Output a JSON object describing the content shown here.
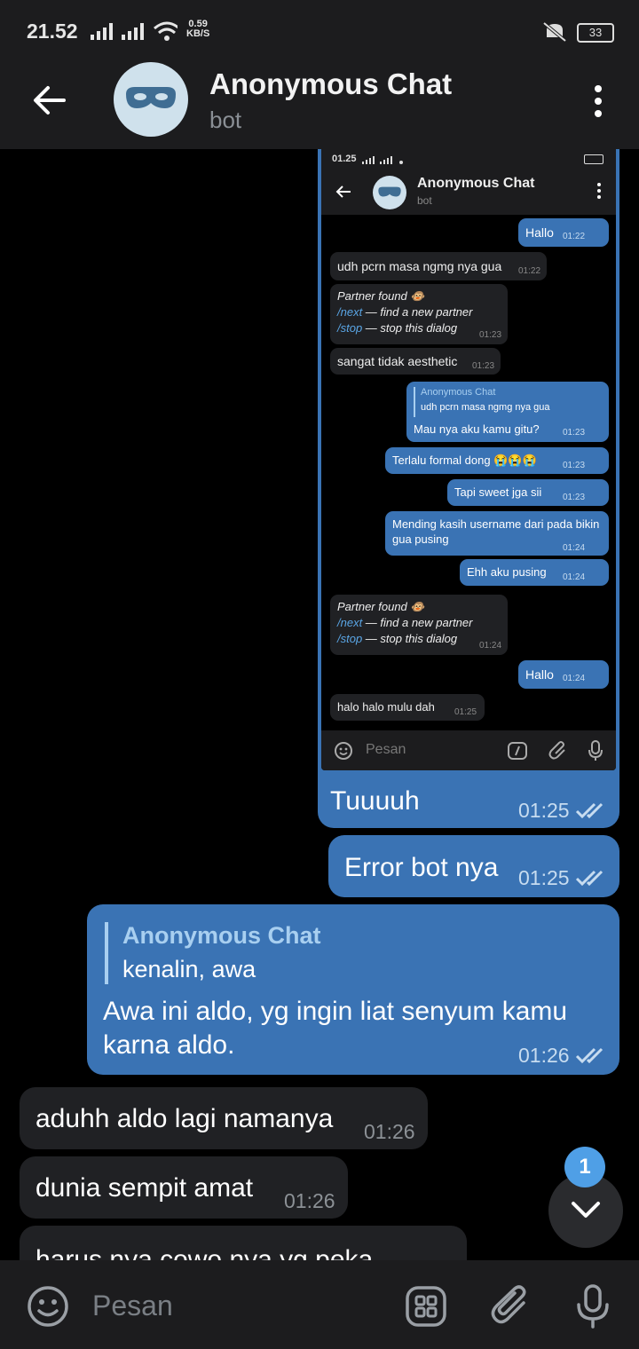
{
  "status_bar": {
    "time": "21.52",
    "speed_value": "0.59",
    "speed_unit": "KB/S",
    "battery": "33"
  },
  "header": {
    "title": "Anonymous Chat",
    "subtitle": "bot"
  },
  "embedded_screenshot": {
    "status_time": "01.25",
    "title": "Anonymous Chat",
    "subtitle": "bot",
    "messages": [
      {
        "dir": "out",
        "text": "Hallo",
        "time": "01:22"
      },
      {
        "dir": "in",
        "text": "udh pcrn masa ngmg nya gua",
        "time": "01:22"
      },
      {
        "dir": "in",
        "line1": "Partner found 🐵",
        "cmd1": "/next",
        "rest1": " — find a new partner",
        "cmd2": "/stop",
        "rest2": " — stop this dialog",
        "time": "01:23"
      },
      {
        "dir": "in",
        "text": "sangat tidak aesthetic",
        "time": "01:23"
      },
      {
        "dir": "out",
        "reply_name": "Anonymous Chat",
        "reply_text": "udh pcrn masa ngmg nya gua",
        "text": "Mau nya aku kamu gitu?",
        "time": "01:23"
      },
      {
        "dir": "out",
        "text": "Terlalu formal dong 😭😭😭",
        "time": "01:23"
      },
      {
        "dir": "out",
        "text": "Tapi sweet jga sii",
        "time": "01:23"
      },
      {
        "dir": "out",
        "text": "Mending kasih username dari pada bikin gua pusing",
        "time": "01:24"
      },
      {
        "dir": "out",
        "text": "Ehh aku pusing",
        "time": "01:24"
      },
      {
        "dir": "in",
        "line1": "Partner found 🐵",
        "cmd1": "/next",
        "rest1": " — find a new partner",
        "cmd2": "/stop",
        "rest2": " — stop this dialog",
        "time": "01:24"
      },
      {
        "dir": "out",
        "text": "Hallo",
        "time": "01:24"
      },
      {
        "dir": "in",
        "text": "halo halo mulu dah",
        "time": "01:25"
      }
    ],
    "input_placeholder": "Pesan"
  },
  "messages": [
    {
      "dir": "out",
      "text": "Tuuuuh",
      "time": "01:25"
    },
    {
      "dir": "out",
      "text": "Error bot nya",
      "time": "01:25"
    },
    {
      "dir": "out",
      "reply_name": "Anonymous Chat",
      "reply_text": "kenalin, awa",
      "text_line1": "Awa ini aldo, yg ingin liat senyum kamu",
      "text_line2": "karna aldo.",
      "time": "01:26"
    },
    {
      "dir": "in",
      "text": "aduhh aldo lagi namanya",
      "time": "01:26"
    },
    {
      "dir": "in",
      "text": "dunia sempit amat",
      "time": "01:26"
    },
    {
      "dir": "in",
      "text": "harus nya cowo nya yg peka"
    }
  ],
  "unread_badge": "1",
  "input": {
    "placeholder": "Pesan"
  },
  "colors": {
    "outgoing": "#3a73b4",
    "incoming": "#202124",
    "accent": "#4f9fe6"
  }
}
